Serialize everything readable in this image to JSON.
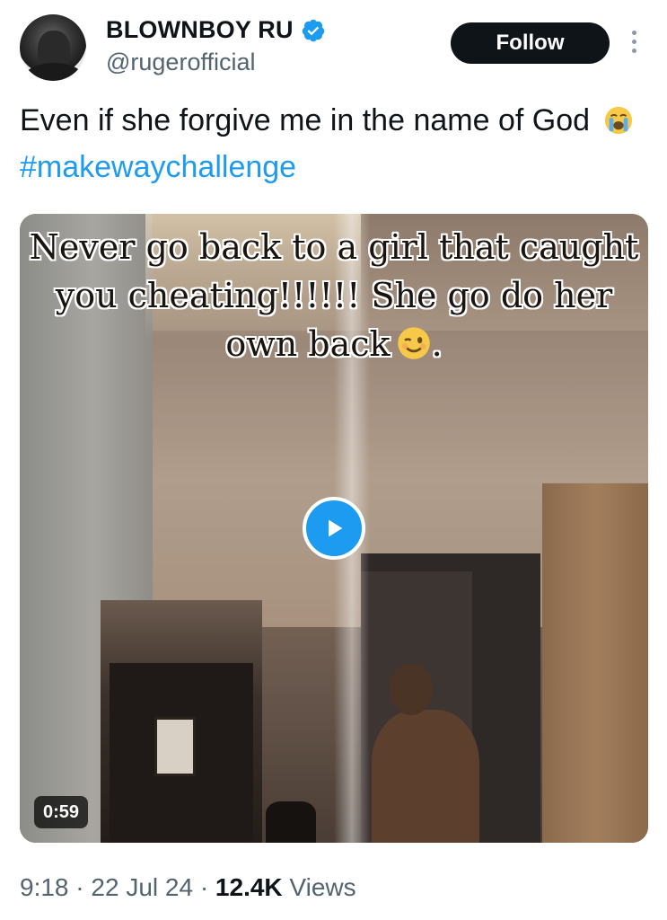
{
  "author": {
    "display_name": "BLOWNBOY RU",
    "handle": "@rugerofficial",
    "verified": true,
    "follow_label": "Follow"
  },
  "tweet": {
    "text_before": "Even if she forgive me in the name of God",
    "text_emoji": "loudly-crying-face",
    "hashtag": "#makewaychallenge"
  },
  "media": {
    "caption": "Never go back to a girl that caught you cheating!!!!!! She go do her own back",
    "caption_emoji": "winking-face",
    "caption_end": ".",
    "duration": "0:59"
  },
  "meta": {
    "time": "9:18",
    "date": "22 Jul 24",
    "views_count": "12.4K",
    "views_label": "Views",
    "separator": "·"
  },
  "colors": {
    "accent": "#1d9bf0",
    "text": "#0f1419",
    "muted": "#536471",
    "follow_bg": "#0f1419"
  }
}
